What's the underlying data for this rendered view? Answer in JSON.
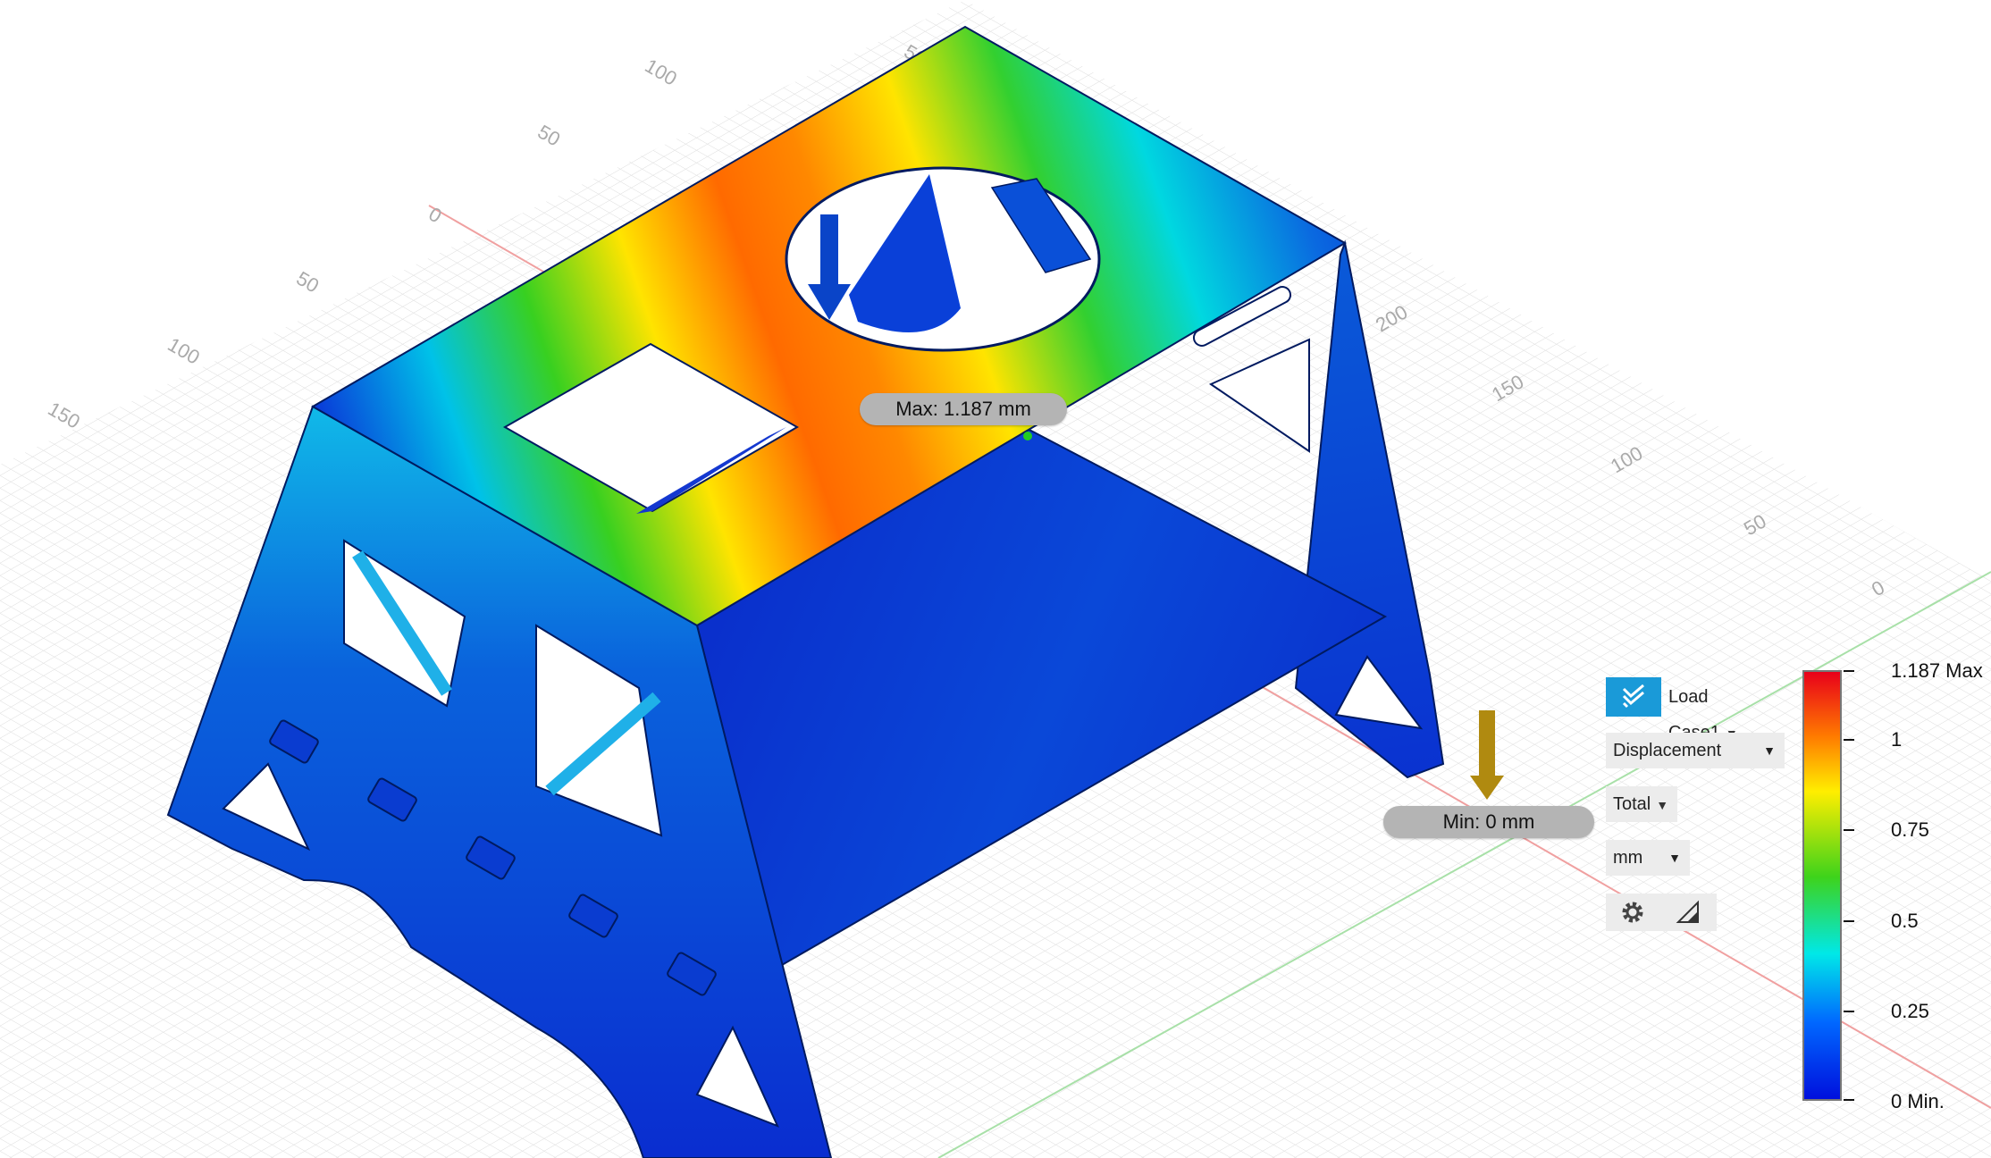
{
  "viewport": {
    "grid_labels": [
      "50",
      "100",
      "50",
      "0",
      "50",
      "100",
      "150",
      "200",
      "150",
      "100",
      "50",
      "0"
    ]
  },
  "annotations": {
    "max_label": "Max: 1.187 mm",
    "min_label": "Min: 0 mm"
  },
  "panel": {
    "load_case": "Load Case1",
    "result_type": "Displacement",
    "component": "Total",
    "unit": "mm"
  },
  "legend": {
    "max_label": "1.187 Max",
    "ticks": [
      "1",
      "0.75",
      "0.5",
      "0.25"
    ],
    "min_label": "0 Min.",
    "colors": [
      "#e8001a",
      "#ff7a00",
      "#ffee00",
      "#3ed31b",
      "#00e8e8",
      "#0068ff",
      "#0010dd"
    ]
  }
}
